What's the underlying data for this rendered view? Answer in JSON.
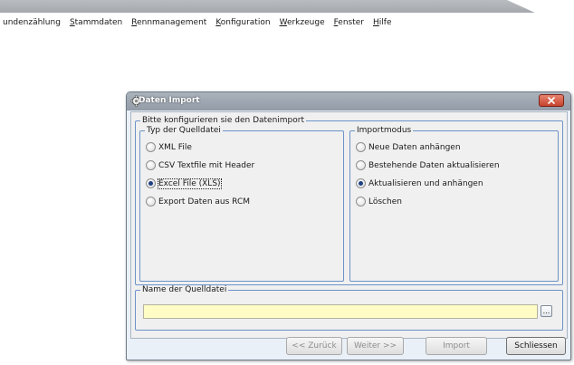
{
  "menu": {
    "items": [
      {
        "pre": "",
        "mn": "",
        "post": "undenzählung"
      },
      {
        "pre": "",
        "mn": "S",
        "post": "tammdaten"
      },
      {
        "pre": "",
        "mn": "R",
        "post": "ennmanagement"
      },
      {
        "pre": "",
        "mn": "K",
        "post": "onfiguration"
      },
      {
        "pre": "",
        "mn": "W",
        "post": "erkzeuge"
      },
      {
        "pre": "",
        "mn": "F",
        "post": "enster"
      },
      {
        "pre": "",
        "mn": "H",
        "post": "ilfe"
      }
    ]
  },
  "dialog": {
    "title": "Daten Import",
    "main_legend": "Bitte konfigurieren sie den Datenimport",
    "source_type": {
      "legend": "Typ der Quelldatei",
      "options": [
        {
          "label": "XML File",
          "checked": false
        },
        {
          "label": "CSV Textfile mit Header",
          "checked": false
        },
        {
          "label": "Excel File (XLS)",
          "checked": true
        },
        {
          "label": "Export Daten aus RCM",
          "checked": false
        }
      ]
    },
    "import_mode": {
      "legend": "Importmodus",
      "options": [
        {
          "label": "Neue Daten anhängen",
          "checked": false
        },
        {
          "label": "Bestehende Daten aktualisieren",
          "checked": false
        },
        {
          "label": "Aktualisieren und anhängen",
          "checked": true
        },
        {
          "label": "Löschen",
          "checked": false
        }
      ]
    },
    "source_file": {
      "legend": "Name der Quelldatei",
      "value": "",
      "browse_label": "..."
    },
    "buttons": {
      "back": "<< Zurück",
      "next": "Weiter >>",
      "import": "Import",
      "close": "Schliessen"
    }
  },
  "colors": {
    "group_border": "#6d93c9",
    "input_background": "#fffcc6",
    "close_button": "#c5432d"
  }
}
